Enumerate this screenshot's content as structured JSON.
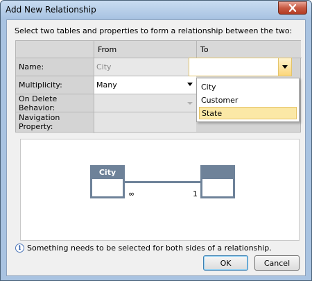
{
  "window": {
    "title": "Add New Relationship"
  },
  "instruction": "Select two tables and properties to form a relationship between the two:",
  "grid": {
    "col_from": "From",
    "col_to": "To",
    "rows": {
      "name": "Name:",
      "multiplicity": "Multiplicity:",
      "on_delete": "On Delete Behavior:",
      "navigation": "Navigation Property:"
    },
    "from_name_value": "City",
    "from_multiplicity_value": "Many",
    "to_name_value": ""
  },
  "dropdown": {
    "options": [
      "City",
      "Customer",
      "State"
    ],
    "selected": "State"
  },
  "diagram": {
    "left_entity": "City",
    "right_entity": "",
    "left_multiplicity": "∞",
    "right_multiplicity": "1"
  },
  "info_text": "Something needs to be selected for both sides of a relationship.",
  "buttons": {
    "ok": "OK",
    "cancel": "Cancel"
  },
  "colors": {
    "entity": "#6e8299",
    "highlight": "#fbe8a6",
    "titlebar": "#a8c3e2"
  }
}
